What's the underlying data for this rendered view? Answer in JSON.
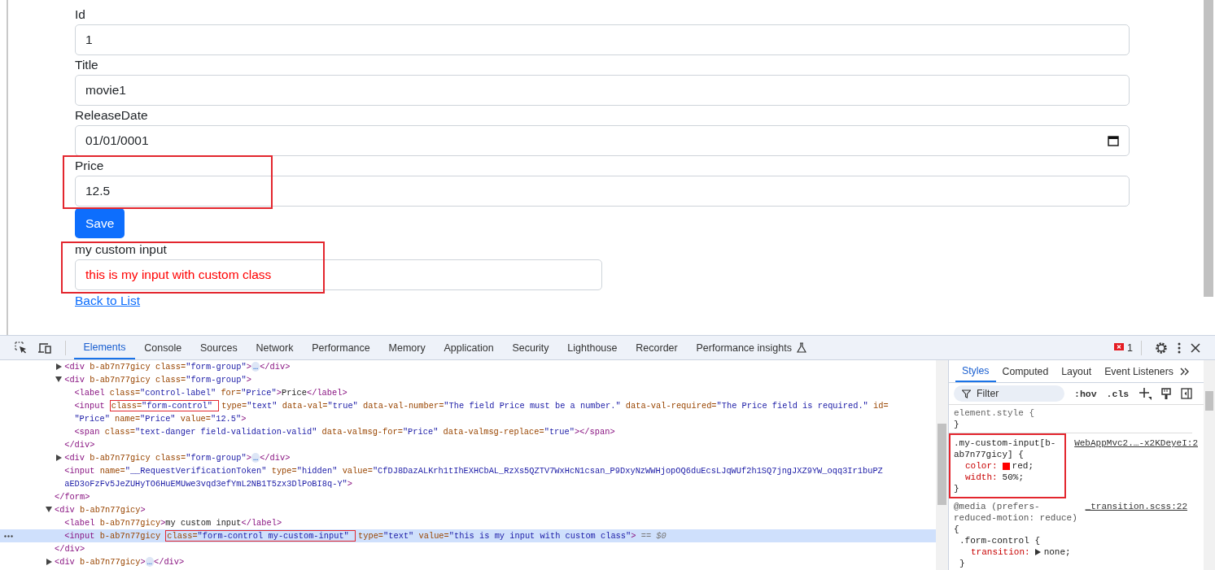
{
  "page": {
    "fields": [
      {
        "label": "Id",
        "value": "1",
        "kind": "text"
      },
      {
        "label": "Title",
        "value": "movie1",
        "kind": "text"
      },
      {
        "label": "ReleaseDate",
        "value": "01/01/0001",
        "kind": "date"
      },
      {
        "label": "Price",
        "value": "12.5",
        "kind": "text",
        "annotated": true
      }
    ],
    "save_button": "Save",
    "custom_field": {
      "label": "my custom input",
      "value": "this is my input with custom class",
      "annotated": true
    },
    "back_link": "Back to List"
  },
  "devtools": {
    "tabs": [
      {
        "label": "Elements",
        "selected": true
      },
      {
        "label": "Console",
        "selected": false
      },
      {
        "label": "Sources",
        "selected": false
      },
      {
        "label": "Network",
        "selected": false
      },
      {
        "label": "Performance",
        "selected": false
      },
      {
        "label": "Memory",
        "selected": false
      },
      {
        "label": "Application",
        "selected": false
      },
      {
        "label": "Security",
        "selected": false
      },
      {
        "label": "Lighthouse",
        "selected": false
      },
      {
        "label": "Recorder",
        "selected": false
      },
      {
        "label": "Performance insights",
        "selected": false,
        "experimental": true
      }
    ],
    "error_count": "1",
    "elements": {
      "tree": [
        {
          "selected": false,
          "children": [
            {
              "selected": false,
              "expanded": false,
              "lines": [
                [
                  {
                    "kind": "tag",
                    "text": "<div"
                  },
                  {
                    "kind": "attr",
                    "text": " b-ab7n77gicy"
                  },
                  {
                    "kind": "attr",
                    "text": " class="
                  },
                  {
                    "kind": "value",
                    "text": "\"form-group\""
                  },
                  {
                    "kind": "tag",
                    "text": ">"
                  },
                  {
                    "kind": "ellipsis",
                    "text": "…"
                  },
                  {
                    "kind": "tag",
                    "text": "</div>"
                  }
                ]
              ]
            },
            {
              "selected": false,
              "expanded": true,
              "lines": [
                [
                  {
                    "kind": "tag",
                    "text": "<div"
                  },
                  {
                    "kind": "attr",
                    "text": " b-ab7n77gicy"
                  },
                  {
                    "kind": "attr",
                    "text": " class="
                  },
                  {
                    "kind": "value",
                    "text": "\"form-group\""
                  },
                  {
                    "kind": "tag",
                    "text": ">"
                  }
                ]
              ],
              "children": [
                {
                  "selected": false,
                  "lines": [
                    [
                      {
                        "kind": "tag",
                        "text": "<label"
                      },
                      {
                        "kind": "attr",
                        "text": " class="
                      },
                      {
                        "kind": "value",
                        "text": "\"control-label\""
                      },
                      {
                        "kind": "attr",
                        "text": " for="
                      },
                      {
                        "kind": "value",
                        "text": "\"Price\""
                      },
                      {
                        "kind": "tag",
                        "text": ">"
                      },
                      {
                        "kind": "text",
                        "text": "Price"
                      },
                      {
                        "kind": "tag",
                        "text": "</label>"
                      }
                    ]
                  ]
                },
                {
                  "selected": false,
                  "lines": [
                    [
                      {
                        "kind": "tag",
                        "text": "<input "
                      },
                      {
                        "kind": "attr",
                        "text": "class=",
                        "boxed": true
                      },
                      {
                        "kind": "value",
                        "text": "\"form-control\" ",
                        "boxed": true
                      },
                      {
                        "kind": "attr",
                        "text": "type="
                      },
                      {
                        "kind": "value",
                        "text": "\"text\""
                      },
                      {
                        "kind": "attr",
                        "text": " data-val="
                      },
                      {
                        "kind": "value",
                        "text": "\"true\""
                      },
                      {
                        "kind": "attr",
                        "text": " data-val-number="
                      },
                      {
                        "kind": "value",
                        "text": "\"The field Price must be a number.\""
                      },
                      {
                        "kind": "attr",
                        "text": " data-val-required="
                      },
                      {
                        "kind": "value",
                        "text": "\"The Price field is required.\""
                      },
                      {
                        "kind": "attr",
                        "text": " id="
                      }
                    ],
                    [
                      {
                        "kind": "value",
                        "text": "\"Price\""
                      },
                      {
                        "kind": "attr",
                        "text": " name="
                      },
                      {
                        "kind": "value",
                        "text": "\"Price\""
                      },
                      {
                        "kind": "attr",
                        "text": " value="
                      },
                      {
                        "kind": "value",
                        "text": "\"12.5\""
                      },
                      {
                        "kind": "tag",
                        "text": ">"
                      }
                    ]
                  ]
                },
                {
                  "selected": false,
                  "lines": [
                    [
                      {
                        "kind": "tag",
                        "text": "<span"
                      },
                      {
                        "kind": "attr",
                        "text": " class="
                      },
                      {
                        "kind": "value",
                        "text": "\"text-danger field-validation-valid\""
                      },
                      {
                        "kind": "attr",
                        "text": " data-valmsg-for="
                      },
                      {
                        "kind": "value",
                        "text": "\"Price\""
                      },
                      {
                        "kind": "attr",
                        "text": " data-valmsg-replace="
                      },
                      {
                        "kind": "value",
                        "text": "\"true\""
                      },
                      {
                        "kind": "tag",
                        "text": "></span>"
                      }
                    ]
                  ]
                }
              ],
              "close": [
                {
                  "kind": "tag",
                  "text": "</div>"
                }
              ]
            },
            {
              "selected": false,
              "expanded": false,
              "lines": [
                [
                  {
                    "kind": "tag",
                    "text": "<div"
                  },
                  {
                    "kind": "attr",
                    "text": " b-ab7n77gicy"
                  },
                  {
                    "kind": "attr",
                    "text": " class="
                  },
                  {
                    "kind": "value",
                    "text": "\"form-group\""
                  },
                  {
                    "kind": "tag",
                    "text": ">"
                  },
                  {
                    "kind": "ellipsis",
                    "text": "…"
                  },
                  {
                    "kind": "tag",
                    "text": "</div>"
                  }
                ]
              ]
            },
            {
              "selected": false,
              "lines": [
                [
                  {
                    "kind": "tag",
                    "text": "<input"
                  },
                  {
                    "kind": "attr",
                    "text": " name="
                  },
                  {
                    "kind": "value",
                    "text": "\"__RequestVerificationToken\""
                  },
                  {
                    "kind": "attr",
                    "text": " type="
                  },
                  {
                    "kind": "value",
                    "text": "\"hidden\""
                  },
                  {
                    "kind": "attr",
                    "text": " value="
                  },
                  {
                    "kind": "value",
                    "text": "\"CfDJ8DazALKrh1tIhEXHCbAL_RzXs5QZTV7WxHcN1csan_P9DxyNzWWHjopOQ6duEcsLJqWUf2h1SQ7jngJXZ9YW_oqq3Ir1buPZ"
                  }
                ],
                [
                  {
                    "kind": "value",
                    "text": "aED3oFzFv5JeZUHyTO6HuEMUwe3vqd3efYmL2NB1T5zx3DlPoBI8q-Y\""
                  },
                  {
                    "kind": "tag",
                    "text": ">"
                  }
                ]
              ]
            }
          ],
          "close": [
            {
              "kind": "tag",
              "text": "</form>"
            }
          ]
        },
        {
          "selected": false,
          "expanded": true,
          "lines": [
            [
              {
                "kind": "tag",
                "text": "<div"
              },
              {
                "kind": "attr",
                "text": " b-ab7n77gicy"
              },
              {
                "kind": "tag",
                "text": ">"
              }
            ]
          ],
          "children": [
            {
              "selected": false,
              "lines": [
                [
                  {
                    "kind": "tag",
                    "text": "<label"
                  },
                  {
                    "kind": "attr",
                    "text": " b-ab7n77gicy"
                  },
                  {
                    "kind": "tag",
                    "text": ">"
                  },
                  {
                    "kind": "text",
                    "text": "my custom input"
                  },
                  {
                    "kind": "tag",
                    "text": "</label>"
                  }
                ]
              ]
            },
            {
              "selected": true,
              "lines": [
                [
                  {
                    "kind": "tag",
                    "text": "<input"
                  },
                  {
                    "kind": "attr",
                    "text": " b-ab7n77gicy "
                  },
                  {
                    "kind": "attr",
                    "text": "class=",
                    "boxed": true
                  },
                  {
                    "kind": "value",
                    "text": "\"form-control my-custom-input\" ",
                    "boxed": true
                  },
                  {
                    "kind": "attr",
                    "text": "type="
                  },
                  {
                    "kind": "value",
                    "text": "\"text\""
                  },
                  {
                    "kind": "attr",
                    "text": " value="
                  },
                  {
                    "kind": "value",
                    "text": "\"this is my input with custom class\""
                  },
                  {
                    "kind": "tag",
                    "text": ">"
                  },
                  {
                    "kind": "marker",
                    "text": " == $0"
                  }
                ]
              ]
            }
          ],
          "close": [
            {
              "kind": "tag",
              "text": "</div>"
            }
          ]
        },
        {
          "selected": false,
          "expanded": false,
          "lines": [
            [
              {
                "kind": "tag",
                "text": "<div"
              },
              {
                "kind": "attr",
                "text": " b-ab7n77gicy"
              },
              {
                "kind": "tag",
                "text": ">"
              },
              {
                "kind": "ellipsis",
                "text": "…"
              },
              {
                "kind": "tag",
                "text": "</div>"
              }
            ]
          ]
        }
      ]
    },
    "styles": {
      "tabs": [
        {
          "label": "Styles",
          "selected": true
        },
        {
          "label": "Computed",
          "selected": false
        },
        {
          "label": "Layout",
          "selected": false
        },
        {
          "label": "Event Listeners",
          "selected": false
        }
      ],
      "filter_placeholder": "Filter",
      "toggles": [
        ":hov",
        ".cls"
      ],
      "rules": [
        {
          "kind": "plain",
          "selector": "element.style {",
          "close": "}"
        },
        {
          "kind": "plain",
          "selector": ".my-custom-input[b-ab7n77gicy] {",
          "source": "WebAppMvc2.…-x2KDeyeI:2",
          "annotated": true,
          "declarations": [
            {
              "property": "color:",
              "value": "red;",
              "color": "#ff0000"
            },
            {
              "property": "width:",
              "value": "50%;"
            }
          ],
          "close": "}"
        },
        {
          "kind": "media",
          "selector": "@media (prefers-reduced-motion: reduce)",
          "open": "{",
          "source": "_transition.scss:22",
          "nested": {
            "selector": ".form-control {",
            "declarations": [
              {
                "property": "transition:",
                "value": "none;",
                "expandable": true
              }
            ],
            "close": "}"
          }
        }
      ]
    }
  }
}
